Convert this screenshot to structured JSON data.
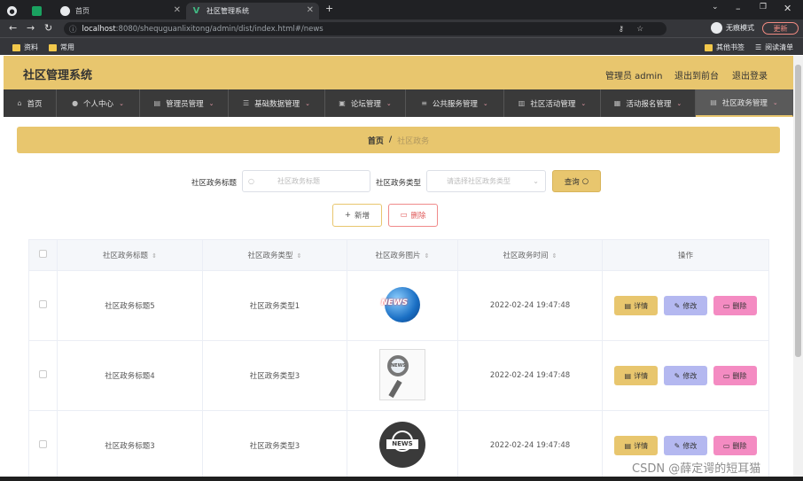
{
  "browser": {
    "tabs": [
      {
        "label": ""
      },
      {
        "label": "首页"
      },
      {
        "label": "社区管理系统"
      }
    ],
    "url_host": "localhost",
    "url_rest": ":8080/shequguanlixitong/admin/dist/index.html#/news",
    "incognito_label": "无痕模式",
    "update_label": "更新",
    "bookmarks": [
      "资料",
      "常用"
    ],
    "bookmarks_right": [
      "其他书签",
      "阅读清单"
    ]
  },
  "header": {
    "title": "社区管理系统",
    "user_label": "管理员 admin",
    "front_label": "退出到前台",
    "logout_label": "退出登录"
  },
  "menu": [
    {
      "label": "首页",
      "icon": "home-icon"
    },
    {
      "label": "个人中心",
      "icon": "user-icon"
    },
    {
      "label": "管理员管理",
      "icon": "admin-icon"
    },
    {
      "label": "基础数据管理",
      "icon": "data-icon"
    },
    {
      "label": "论坛管理",
      "icon": "forum-icon"
    },
    {
      "label": "公共服务管理",
      "icon": "service-icon"
    },
    {
      "label": "社区活动管理",
      "icon": "activity-icon"
    },
    {
      "label": "活动报名管理",
      "icon": "signup-icon"
    },
    {
      "label": "社区政务管理",
      "icon": "affairs-icon"
    }
  ],
  "breadcrumb": {
    "home": "首页",
    "current": "社区政务"
  },
  "search": {
    "title_label": "社区政务标题",
    "title_placeholder": "社区政务标题",
    "type_label": "社区政务类型",
    "type_placeholder": "请选择社区政务类型",
    "query_label": "查询"
  },
  "actions": {
    "add_label": "新增",
    "delete_label": "删除"
  },
  "table": {
    "headers": [
      "社区政务标题",
      "社区政务类型",
      "社区政务图片",
      "社区政务时间",
      "操作"
    ],
    "rows": [
      {
        "title": "社区政务标题5",
        "type": "社区政务类型1",
        "image": "news-globe",
        "time": "2022-02-24 19:47:48"
      },
      {
        "title": "社区政务标题4",
        "type": "社区政务类型3",
        "image": "news-magnifier",
        "time": "2022-02-24 19:47:48"
      },
      {
        "title": "社区政务标题3",
        "type": "社区政务类型3",
        "image": "news-dark-globe",
        "time": "2022-02-24 19:47:48"
      }
    ],
    "op_detail": "详情",
    "op_edit": "修改",
    "op_delete": "删除"
  },
  "thumb_text": {
    "globe": "NEWS",
    "paper": "NEWS",
    "dark": "NEWS"
  },
  "watermark": "CSDN @薛定谔的短耳猫",
  "colors": {
    "accent": "#e8c66e",
    "menu_bg": "#3a3a3a",
    "edit": "#b4b8f0",
    "delete": "#f48bc2"
  }
}
